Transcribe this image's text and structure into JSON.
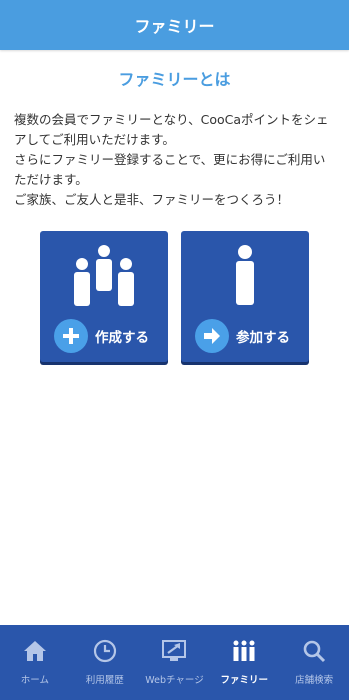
{
  "header": {
    "title": "ファミリー"
  },
  "section": {
    "title": "ファミリーとは"
  },
  "description": [
    "複数の会員でファミリーとなり、CooCaポイントをシェアしてご利用いただけます。",
    "さらにファミリー登録することで、更にお得にご利用いただけます。",
    "ご家族、ご友人と是非、ファミリーをつくろう！"
  ],
  "actions": {
    "create": {
      "label": "作成する",
      "icon": "plus-icon",
      "figure": "group-people-icon"
    },
    "join": {
      "label": "参加する",
      "icon": "arrow-right-icon",
      "figure": "person-icon"
    }
  },
  "tabbar": {
    "items": [
      {
        "label": "ホーム",
        "icon": "home-icon"
      },
      {
        "label": "利用履歴",
        "icon": "clock-icon"
      },
      {
        "label": "Webチャージ",
        "icon": "web-charge-icon"
      },
      {
        "label": "ファミリー",
        "icon": "family-icon",
        "active": true
      },
      {
        "label": "店舗検索",
        "icon": "search-icon"
      }
    ]
  },
  "colors": {
    "header": "#4a9de0",
    "accent": "#4a9de0",
    "tile": "#2a56ab",
    "tabbar": "#2a56ab"
  }
}
